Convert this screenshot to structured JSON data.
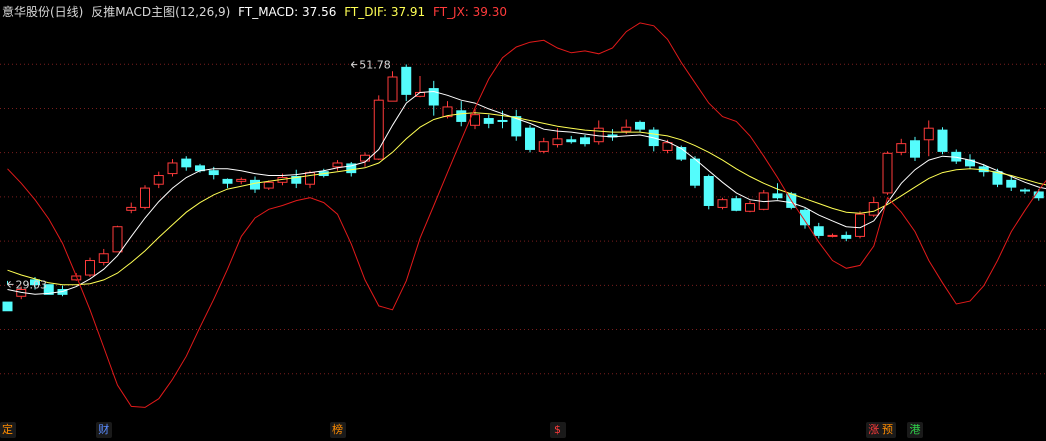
{
  "header": {
    "title": "意华股份(日线)",
    "indicator_name": "反推MACD主图(12,26,9)",
    "ft_macd_text": "FT_MACD: 37.56",
    "ft_dif_text": "FT_DIF: 37.91",
    "ft_jx_text": "FT_JX: 39.30"
  },
  "colors": {
    "up": "#ff3b3b",
    "down": "#54fcfc",
    "white_line": "#ffffff",
    "yellow_line": "#ffff54",
    "red_line": "#e21a1a",
    "grid": "#7a1e1e",
    "text": "#d8d8d8"
  },
  "chart_data": {
    "type": "candlestick",
    "ylim": [
      15.2,
      56.4
    ],
    "grid": "horizontal dotted lines",
    "annotations": [
      {
        "text": "51.78",
        "value": 51.78,
        "candle_index": 25
      },
      {
        "text": "29.03",
        "value": 29.03,
        "candle_index": 0
      }
    ],
    "candles": [
      [
        0,
        27.2,
        26.3,
        29.0,
        29.4
      ],
      [
        1,
        27.8,
        28.5,
        27.5,
        28.8
      ],
      [
        2,
        29.5,
        29.0,
        28.5,
        29.8
      ],
      [
        3,
        29.0,
        28.0,
        28.6,
        28.4
      ],
      [
        4,
        28.5,
        28.0,
        27.8,
        28.9
      ],
      [
        5,
        29.5,
        29.9,
        29.4,
        30.2
      ],
      [
        6,
        30.0,
        31.5,
        29.8,
        31.8
      ],
      [
        7,
        31.3,
        32.2,
        31.0,
        32.7
      ],
      [
        8,
        32.4,
        35.0,
        32.4,
        35.1
      ],
      [
        9,
        36.7,
        37.0,
        36.4,
        37.5
      ],
      [
        10,
        37.0,
        39.0,
        36.8,
        39.3
      ],
      [
        11,
        39.4,
        40.3,
        39.0,
        40.7
      ],
      [
        12,
        40.5,
        41.6,
        40.2,
        42.0
      ],
      [
        13,
        42.0,
        41.2,
        40.8,
        42.3
      ],
      [
        14,
        41.3,
        40.8,
        40.6,
        41.5
      ],
      [
        15,
        40.8,
        40.4,
        39.9,
        41.2
      ],
      [
        16,
        39.9,
        39.5,
        39.0,
        40.0
      ],
      [
        17,
        39.7,
        39.9,
        39.4,
        40.1
      ],
      [
        18,
        39.8,
        38.9,
        38.5,
        40.2
      ],
      [
        19,
        39.0,
        39.6,
        38.8,
        39.8
      ],
      [
        20,
        39.6,
        40.1,
        39.3,
        40.5
      ],
      [
        21,
        40.2,
        39.5,
        39.0,
        40.9
      ],
      [
        22,
        39.4,
        40.6,
        39.0,
        40.8
      ],
      [
        23,
        40.7,
        40.3,
        40.1,
        41.0
      ],
      [
        24,
        41.2,
        41.6,
        40.8,
        41.9
      ],
      [
        25,
        41.5,
        40.6,
        40.2,
        41.7
      ],
      [
        26,
        41.8,
        42.4,
        41.2,
        42.7
      ],
      [
        27,
        42.0,
        48.1,
        41.9,
        48.6
      ],
      [
        28,
        48.0,
        50.5,
        48.0,
        51.1
      ],
      [
        29,
        51.5,
        48.7,
        48.0,
        51.8
      ],
      [
        30,
        48.5,
        48.9,
        48.4,
        50.6
      ],
      [
        31,
        49.3,
        47.6,
        46.5,
        50.1
      ],
      [
        32,
        46.4,
        47.4,
        46.2,
        48.0
      ],
      [
        33,
        47.0,
        45.9,
        45.4,
        48.0
      ],
      [
        34,
        45.5,
        46.6,
        45.1,
        47.2
      ],
      [
        35,
        46.2,
        45.7,
        45.2,
        46.6
      ],
      [
        36,
        46.0,
        45.9,
        45.2,
        47.0
      ],
      [
        37,
        46.4,
        44.4,
        43.9,
        47.1
      ],
      [
        38,
        45.2,
        43.0,
        42.7,
        45.5
      ],
      [
        39,
        42.8,
        43.8,
        42.6,
        44.2
      ],
      [
        40,
        43.5,
        44.1,
        43.2,
        45.2
      ],
      [
        41,
        44.0,
        43.8,
        43.6,
        44.4
      ],
      [
        42,
        44.2,
        43.6,
        43.3,
        44.5
      ],
      [
        43,
        43.8,
        45.2,
        43.5,
        46.0
      ],
      [
        44,
        44.5,
        44.3,
        43.9,
        45.1
      ],
      [
        45,
        44.9,
        45.3,
        44.6,
        46.1
      ],
      [
        46,
        45.8,
        45.1,
        44.8,
        46.0
      ],
      [
        47,
        45.0,
        43.4,
        42.8,
        45.3
      ],
      [
        48,
        42.9,
        43.7,
        42.6,
        44.0
      ],
      [
        49,
        43.2,
        42.0,
        41.8,
        43.4
      ],
      [
        50,
        42.0,
        39.3,
        39.0,
        42.3
      ],
      [
        51,
        40.2,
        37.2,
        36.8,
        40.4
      ],
      [
        52,
        37.0,
        37.8,
        36.8,
        38.0
      ],
      [
        53,
        37.9,
        36.7,
        36.6,
        38.2
      ],
      [
        54,
        36.6,
        37.4,
        36.5,
        37.7
      ],
      [
        55,
        36.8,
        38.5,
        36.7,
        38.8
      ],
      [
        56,
        38.4,
        38.0,
        37.8,
        39.5
      ],
      [
        57,
        38.4,
        37.0,
        36.8,
        38.6
      ],
      [
        58,
        36.7,
        35.2,
        34.8,
        36.9
      ],
      [
        59,
        35.0,
        34.1,
        33.8,
        35.4
      ],
      [
        60,
        34.0,
        34.1,
        33.9,
        34.3
      ],
      [
        61,
        34.1,
        33.8,
        33.5,
        34.5
      ],
      [
        62,
        34.0,
        36.3,
        33.8,
        36.6
      ],
      [
        63,
        36.2,
        37.5,
        36.0,
        38.1
      ],
      [
        64,
        38.5,
        42.6,
        38.3,
        42.8
      ],
      [
        65,
        42.7,
        43.6,
        42.4,
        44.1
      ],
      [
        66,
        43.9,
        42.2,
        41.8,
        44.3
      ],
      [
        67,
        44.0,
        45.2,
        42.3,
        46.0
      ],
      [
        68,
        45.0,
        42.8,
        42.5,
        45.3
      ],
      [
        69,
        42.7,
        41.8,
        41.5,
        43.0
      ],
      [
        70,
        41.9,
        41.3,
        41.0,
        42.5
      ],
      [
        71,
        41.2,
        40.7,
        40.2,
        41.5
      ],
      [
        72,
        40.7,
        39.4,
        39.1,
        41.0
      ],
      [
        73,
        39.8,
        39.1,
        38.7,
        40.2
      ],
      [
        74,
        38.8,
        38.7,
        38.4,
        39.0
      ],
      [
        75,
        38.6,
        38.0,
        37.7,
        38.9
      ],
      [
        76,
        38.0,
        38.6,
        37.7,
        38.9
      ]
    ],
    "series": [
      {
        "color_key": "white_line",
        "values": [
          28.5,
          28.2,
          28.0,
          28.1,
          28.3,
          28.8,
          29.6,
          30.6,
          32.0,
          34.0,
          35.9,
          37.6,
          39.0,
          40.1,
          40.8,
          41.0,
          41.0,
          40.8,
          40.5,
          40.3,
          40.3,
          40.4,
          40.6,
          40.8,
          41.1,
          41.3,
          41.7,
          43.0,
          45.5,
          47.8,
          48.9,
          49.0,
          48.6,
          48.1,
          47.8,
          47.2,
          46.7,
          46.2,
          45.7,
          45.1,
          44.9,
          44.8,
          44.6,
          44.4,
          44.3,
          44.4,
          44.5,
          44.2,
          43.8,
          43.1,
          42.0,
          40.8,
          39.6,
          38.5,
          37.8,
          37.6,
          37.7,
          37.5,
          37.0,
          36.2,
          35.6,
          35.0,
          34.9,
          35.6,
          37.5,
          39.5,
          40.9,
          41.9,
          42.3,
          42.2,
          41.9,
          41.4,
          40.8,
          40.2,
          39.6,
          39.1,
          38.8
        ]
      },
      {
        "color_key": "yellow_line",
        "values": [
          30.5,
          30.0,
          29.6,
          29.2,
          29.0,
          29.0,
          29.1,
          29.5,
          30.2,
          31.3,
          32.5,
          33.9,
          35.2,
          36.5,
          37.5,
          38.3,
          38.9,
          39.2,
          39.5,
          39.7,
          39.9,
          40.1,
          40.3,
          40.5,
          40.7,
          40.9,
          41.1,
          41.6,
          42.7,
          44.1,
          45.3,
          46.1,
          46.5,
          46.7,
          46.8,
          46.7,
          46.5,
          46.3,
          46.0,
          45.7,
          45.4,
          45.2,
          45.0,
          44.9,
          44.8,
          44.8,
          44.8,
          44.6,
          44.4,
          44.0,
          43.4,
          42.7,
          41.9,
          41.0,
          40.2,
          39.5,
          38.9,
          38.4,
          37.9,
          37.4,
          36.9,
          36.5,
          36.4,
          36.6,
          37.3,
          38.2,
          39.1,
          40.0,
          40.6,
          40.9,
          41.0,
          40.9,
          40.6,
          40.3,
          39.9,
          39.5,
          39.2
        ]
      },
      {
        "color_key": "red_line",
        "values": [
          41.0,
          39.5,
          37.8,
          35.8,
          33.3,
          29.9,
          26.4,
          22.5,
          18.6,
          16.4,
          16.3,
          17.2,
          19.2,
          21.6,
          24.6,
          27.5,
          30.6,
          34.0,
          35.9,
          36.8,
          37.2,
          37.7,
          38.0,
          37.5,
          36.3,
          33.2,
          29.5,
          26.8,
          26.4,
          29.4,
          33.8,
          37.2,
          40.6,
          44.0,
          47.3,
          50.3,
          52.5,
          53.6,
          54.1,
          54.3,
          53.5,
          53.0,
          53.2,
          52.9,
          53.5,
          55.2,
          56.1,
          55.8,
          54.4,
          52.0,
          49.9,
          47.8,
          46.4,
          45.9,
          44.4,
          42.3,
          40.1,
          37.7,
          35.6,
          33.4,
          31.5,
          30.7,
          31.0,
          33.0,
          38.0,
          36.5,
          34.5,
          31.5,
          29.2,
          27.0,
          27.3,
          28.9,
          31.5,
          34.5,
          36.7,
          38.8,
          40.6
        ]
      }
    ]
  },
  "bottom_marks": [
    {
      "text": "定",
      "color": "#ff8c00",
      "candle_index": 0
    },
    {
      "text": "财",
      "color": "#5a8cff",
      "candle_index": 7
    },
    {
      "text": "榜",
      "color": "#ff8c00",
      "candle_index": 24
    },
    {
      "text": "$",
      "color": "#ff3b3b",
      "candle_index": 40
    },
    {
      "text": "涨",
      "color": "#ff3b3b",
      "candle_index": 63
    },
    {
      "text": "预",
      "color": "#ff8c00",
      "candle_index": 64
    },
    {
      "text": "港",
      "color": "#2fd24a",
      "candle_index": 66
    }
  ]
}
